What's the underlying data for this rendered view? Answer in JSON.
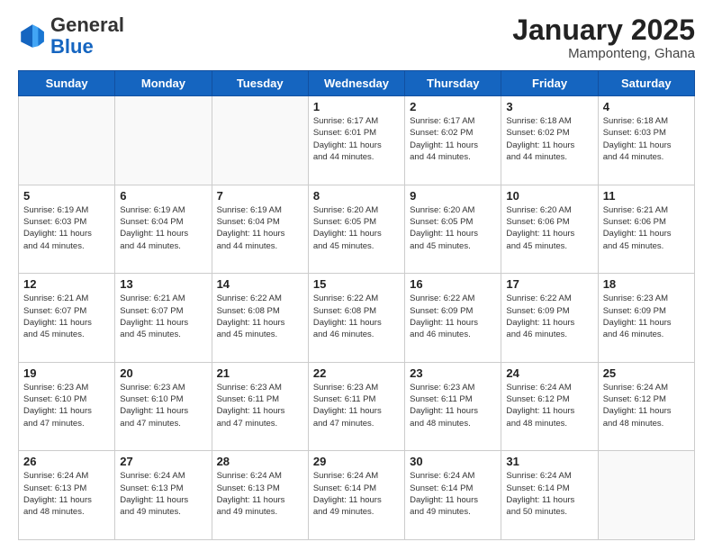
{
  "header": {
    "logo_general": "General",
    "logo_blue": "Blue",
    "title": "January 2025",
    "subtitle": "Mamponteng, Ghana"
  },
  "calendar": {
    "days_of_week": [
      "Sunday",
      "Monday",
      "Tuesday",
      "Wednesday",
      "Thursday",
      "Friday",
      "Saturday"
    ],
    "weeks": [
      [
        {
          "day": "",
          "info": ""
        },
        {
          "day": "",
          "info": ""
        },
        {
          "day": "",
          "info": ""
        },
        {
          "day": "1",
          "info": "Sunrise: 6:17 AM\nSunset: 6:01 PM\nDaylight: 11 hours\nand 44 minutes."
        },
        {
          "day": "2",
          "info": "Sunrise: 6:17 AM\nSunset: 6:02 PM\nDaylight: 11 hours\nand 44 minutes."
        },
        {
          "day": "3",
          "info": "Sunrise: 6:18 AM\nSunset: 6:02 PM\nDaylight: 11 hours\nand 44 minutes."
        },
        {
          "day": "4",
          "info": "Sunrise: 6:18 AM\nSunset: 6:03 PM\nDaylight: 11 hours\nand 44 minutes."
        }
      ],
      [
        {
          "day": "5",
          "info": "Sunrise: 6:19 AM\nSunset: 6:03 PM\nDaylight: 11 hours\nand 44 minutes."
        },
        {
          "day": "6",
          "info": "Sunrise: 6:19 AM\nSunset: 6:04 PM\nDaylight: 11 hours\nand 44 minutes."
        },
        {
          "day": "7",
          "info": "Sunrise: 6:19 AM\nSunset: 6:04 PM\nDaylight: 11 hours\nand 44 minutes."
        },
        {
          "day": "8",
          "info": "Sunrise: 6:20 AM\nSunset: 6:05 PM\nDaylight: 11 hours\nand 45 minutes."
        },
        {
          "day": "9",
          "info": "Sunrise: 6:20 AM\nSunset: 6:05 PM\nDaylight: 11 hours\nand 45 minutes."
        },
        {
          "day": "10",
          "info": "Sunrise: 6:20 AM\nSunset: 6:06 PM\nDaylight: 11 hours\nand 45 minutes."
        },
        {
          "day": "11",
          "info": "Sunrise: 6:21 AM\nSunset: 6:06 PM\nDaylight: 11 hours\nand 45 minutes."
        }
      ],
      [
        {
          "day": "12",
          "info": "Sunrise: 6:21 AM\nSunset: 6:07 PM\nDaylight: 11 hours\nand 45 minutes."
        },
        {
          "day": "13",
          "info": "Sunrise: 6:21 AM\nSunset: 6:07 PM\nDaylight: 11 hours\nand 45 minutes."
        },
        {
          "day": "14",
          "info": "Sunrise: 6:22 AM\nSunset: 6:08 PM\nDaylight: 11 hours\nand 45 minutes."
        },
        {
          "day": "15",
          "info": "Sunrise: 6:22 AM\nSunset: 6:08 PM\nDaylight: 11 hours\nand 46 minutes."
        },
        {
          "day": "16",
          "info": "Sunrise: 6:22 AM\nSunset: 6:09 PM\nDaylight: 11 hours\nand 46 minutes."
        },
        {
          "day": "17",
          "info": "Sunrise: 6:22 AM\nSunset: 6:09 PM\nDaylight: 11 hours\nand 46 minutes."
        },
        {
          "day": "18",
          "info": "Sunrise: 6:23 AM\nSunset: 6:09 PM\nDaylight: 11 hours\nand 46 minutes."
        }
      ],
      [
        {
          "day": "19",
          "info": "Sunrise: 6:23 AM\nSunset: 6:10 PM\nDaylight: 11 hours\nand 47 minutes."
        },
        {
          "day": "20",
          "info": "Sunrise: 6:23 AM\nSunset: 6:10 PM\nDaylight: 11 hours\nand 47 minutes."
        },
        {
          "day": "21",
          "info": "Sunrise: 6:23 AM\nSunset: 6:11 PM\nDaylight: 11 hours\nand 47 minutes."
        },
        {
          "day": "22",
          "info": "Sunrise: 6:23 AM\nSunset: 6:11 PM\nDaylight: 11 hours\nand 47 minutes."
        },
        {
          "day": "23",
          "info": "Sunrise: 6:23 AM\nSunset: 6:11 PM\nDaylight: 11 hours\nand 48 minutes."
        },
        {
          "day": "24",
          "info": "Sunrise: 6:24 AM\nSunset: 6:12 PM\nDaylight: 11 hours\nand 48 minutes."
        },
        {
          "day": "25",
          "info": "Sunrise: 6:24 AM\nSunset: 6:12 PM\nDaylight: 11 hours\nand 48 minutes."
        }
      ],
      [
        {
          "day": "26",
          "info": "Sunrise: 6:24 AM\nSunset: 6:13 PM\nDaylight: 11 hours\nand 48 minutes."
        },
        {
          "day": "27",
          "info": "Sunrise: 6:24 AM\nSunset: 6:13 PM\nDaylight: 11 hours\nand 49 minutes."
        },
        {
          "day": "28",
          "info": "Sunrise: 6:24 AM\nSunset: 6:13 PM\nDaylight: 11 hours\nand 49 minutes."
        },
        {
          "day": "29",
          "info": "Sunrise: 6:24 AM\nSunset: 6:14 PM\nDaylight: 11 hours\nand 49 minutes."
        },
        {
          "day": "30",
          "info": "Sunrise: 6:24 AM\nSunset: 6:14 PM\nDaylight: 11 hours\nand 49 minutes."
        },
        {
          "day": "31",
          "info": "Sunrise: 6:24 AM\nSunset: 6:14 PM\nDaylight: 11 hours\nand 50 minutes."
        },
        {
          "day": "",
          "info": ""
        }
      ]
    ]
  }
}
